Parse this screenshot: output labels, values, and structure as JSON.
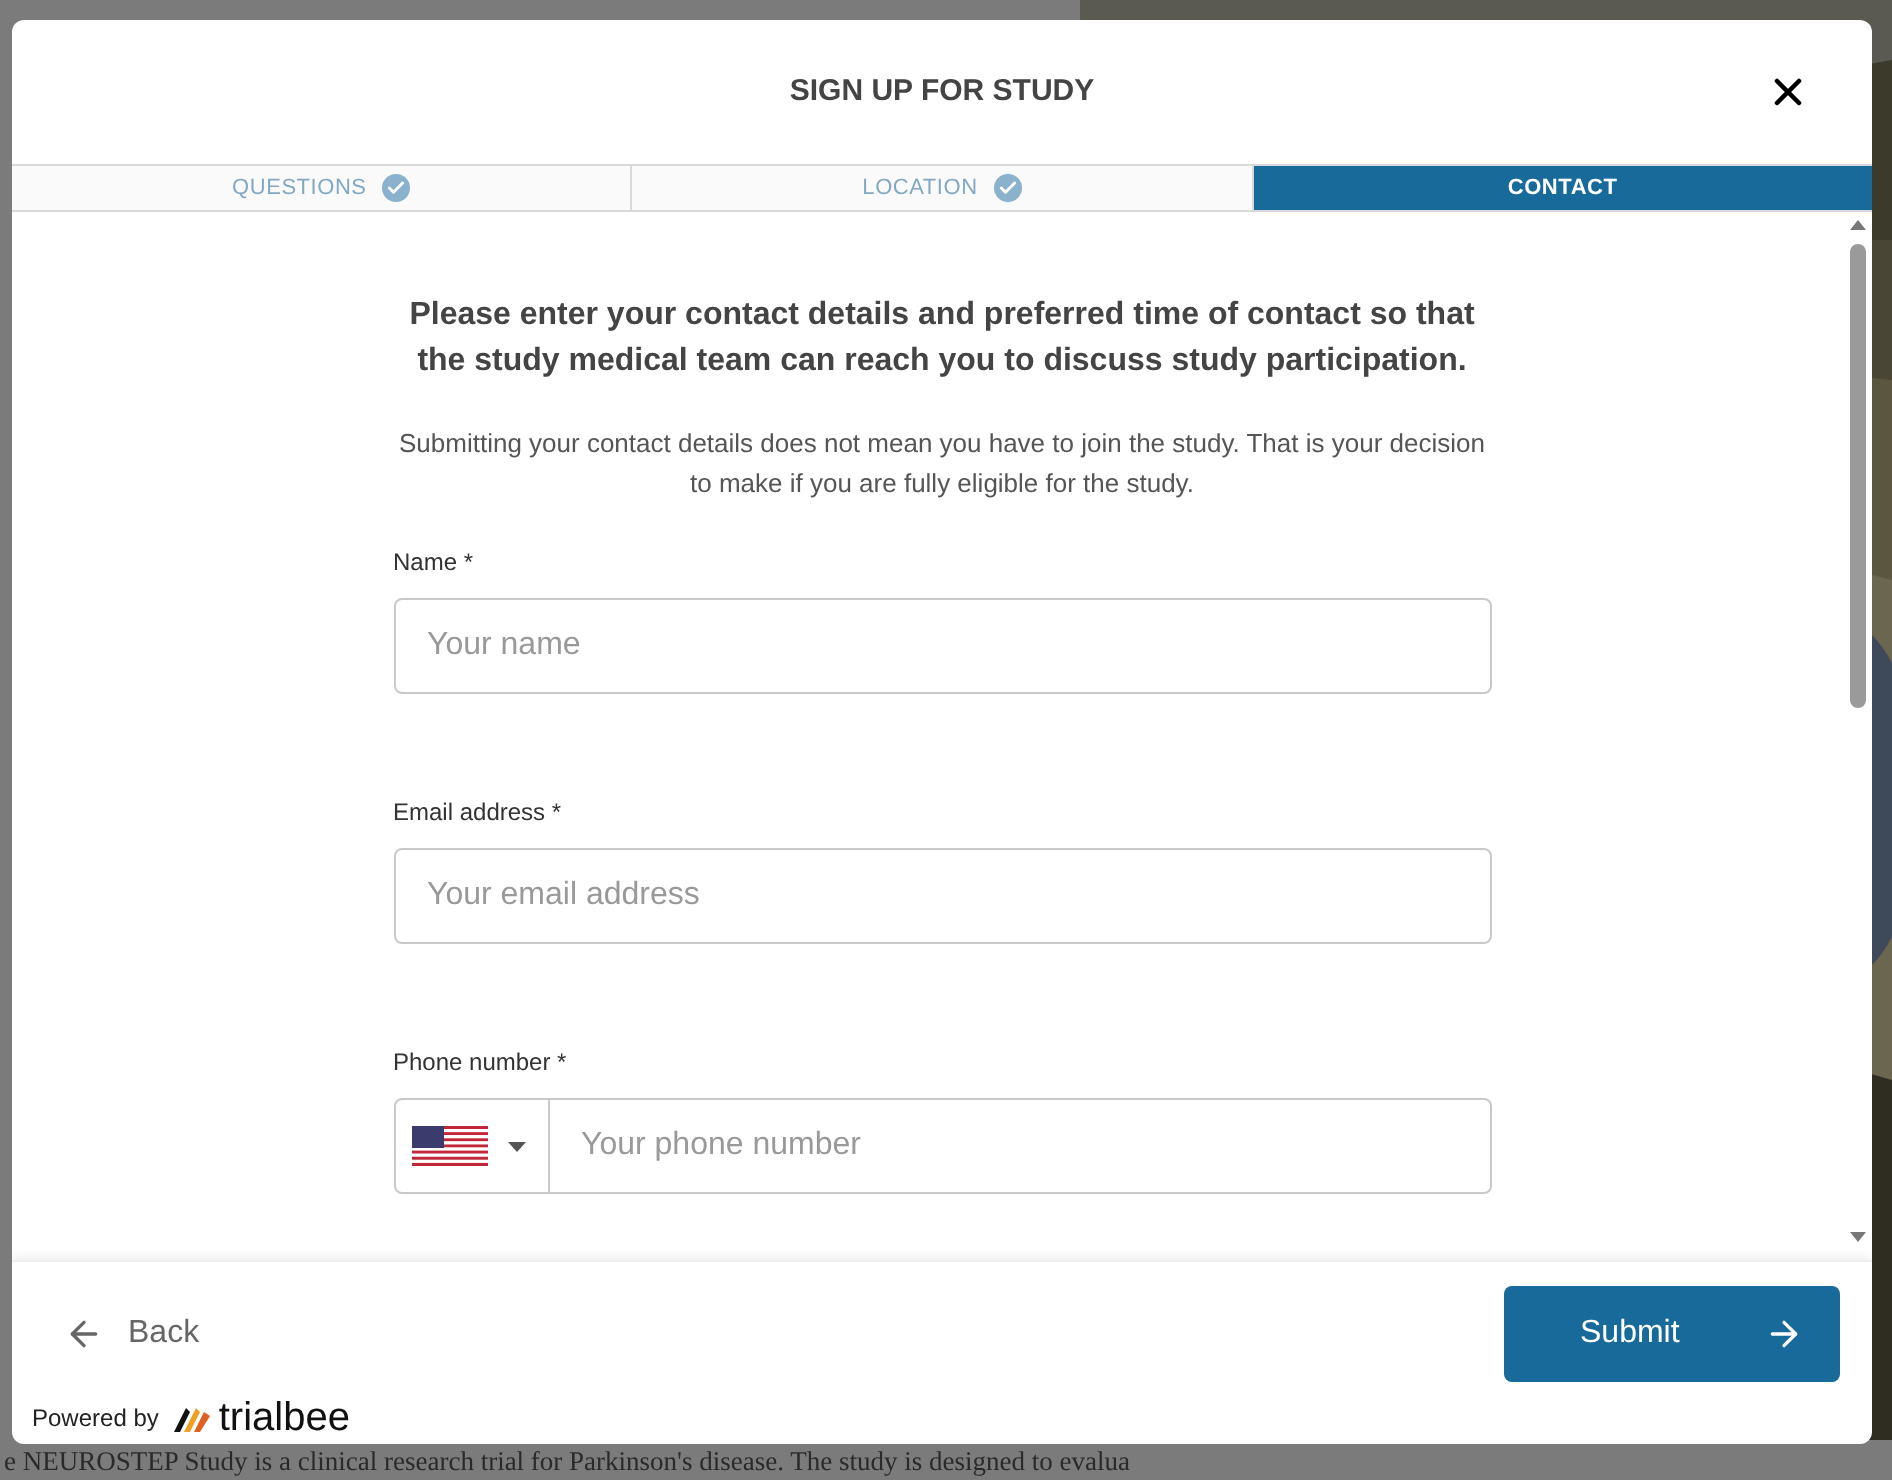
{
  "background": {
    "sentence": "e NEUROSTEP Study is a clinical research trial for Parkinson's disease. The study is designed to evalua"
  },
  "dialog": {
    "title": "SIGN UP FOR STUDY",
    "steps": [
      {
        "label": "QUESTIONS",
        "done": true,
        "selected": false
      },
      {
        "label": "LOCATION",
        "done": true,
        "selected": false
      },
      {
        "label": "CONTACT",
        "done": false,
        "selected": true
      }
    ],
    "intro": "Please enter your contact details and preferred time of contact so that the study medical team can reach you to discuss study participation.",
    "note": "Submitting your contact details does not mean you have to join the study. That is your decision to make if you are fully eligible for the study.",
    "fields": [
      {
        "kind": "text",
        "label": "Name *",
        "placeholder": "Your name"
      },
      {
        "kind": "text",
        "label": "Email address *",
        "placeholder": "Your email address"
      },
      {
        "kind": "phone",
        "label": "Phone number *",
        "placeholder": "Your phone number"
      }
    ],
    "back": "Back",
    "submit": "Submit",
    "powered_by": "Powered by",
    "brand": "trialbee"
  }
}
